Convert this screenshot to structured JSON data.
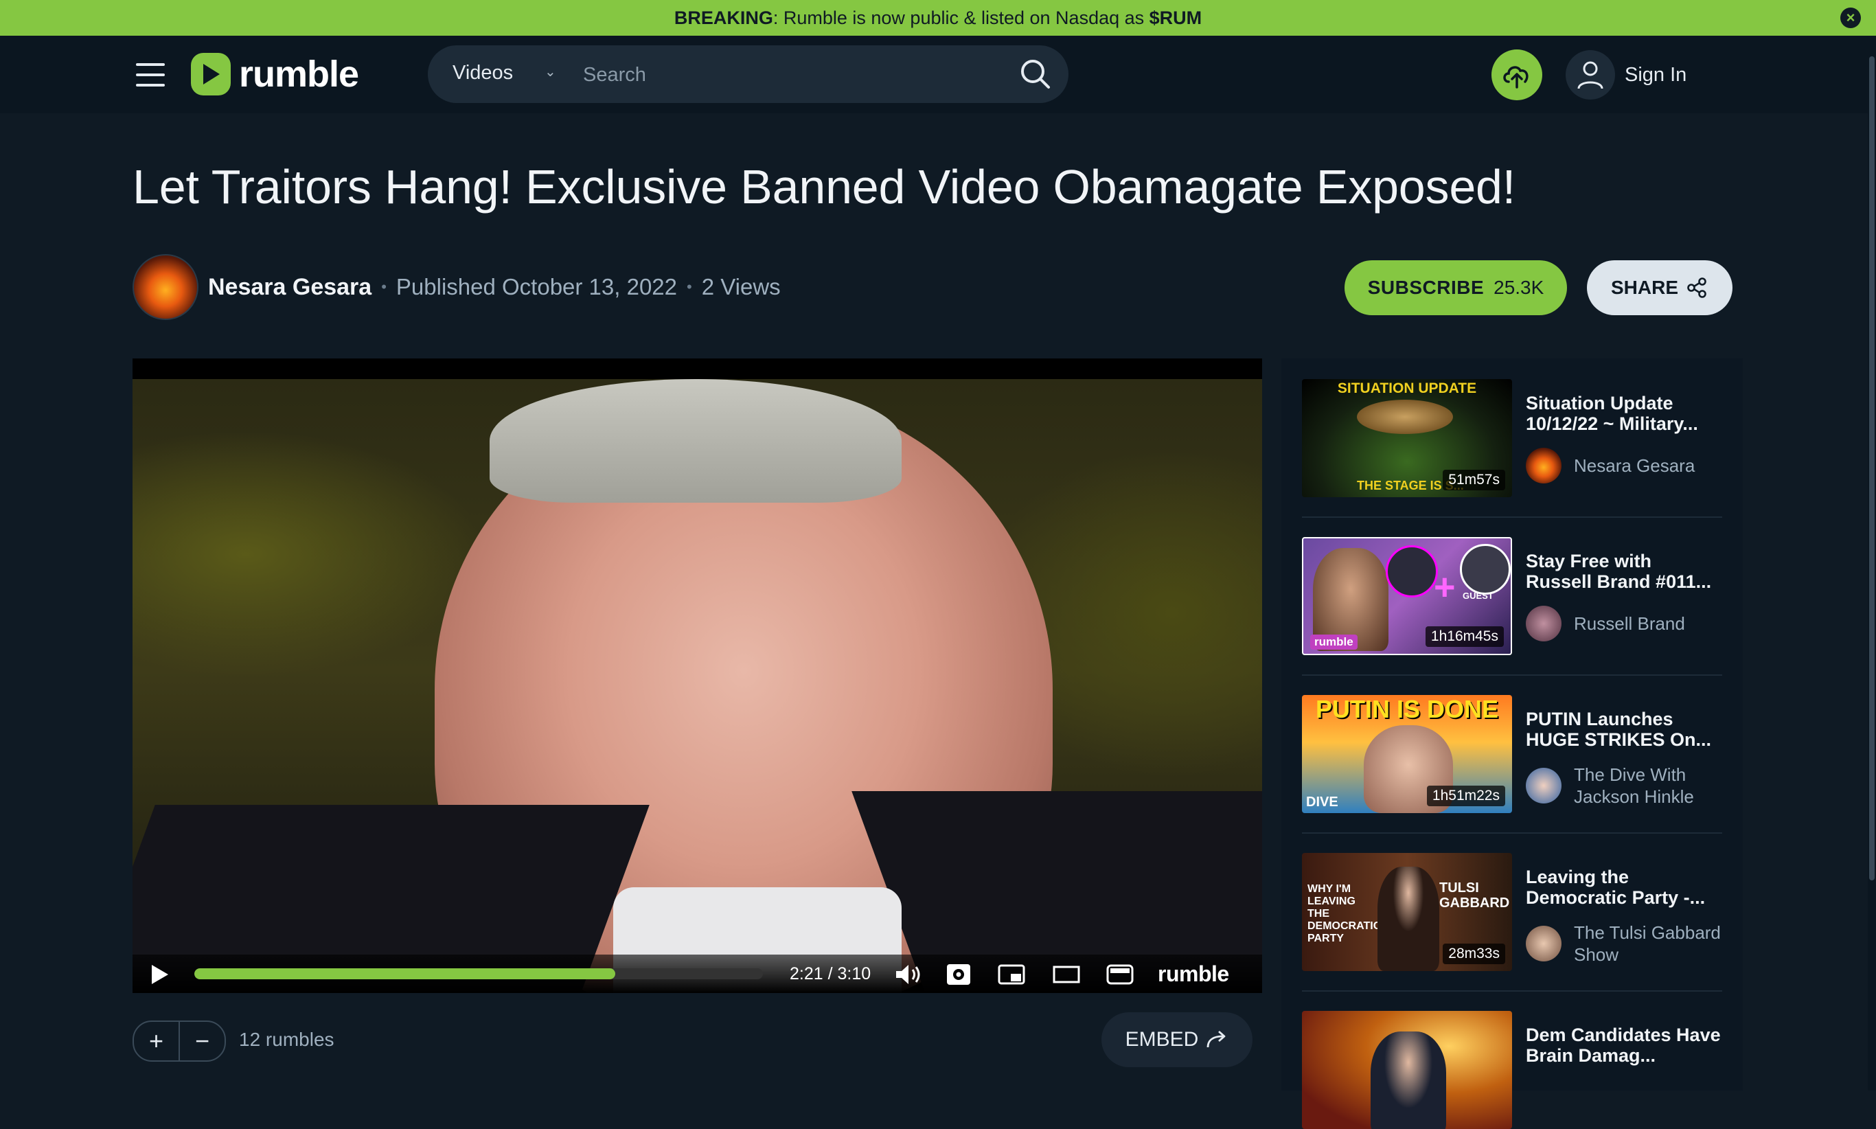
{
  "banner": {
    "label": "BREAKING",
    "message": ": Rumble is now public & listed on Nasdaq as ",
    "ticker": "$RUM",
    "close": "×"
  },
  "header": {
    "logo_text": "rumble",
    "search_category": "Videos",
    "search_placeholder": "Search",
    "sign_in": "Sign In"
  },
  "video": {
    "title": "Let Traitors Hang! Exclusive Banned Video Obamagate Exposed!",
    "channel": "Nesara Gesara",
    "published": "Published October 13, 2022",
    "views": "2 Views",
    "subscribe_label": "SUBSCRIBE",
    "subscribers": "25.3K",
    "share_label": "SHARE",
    "time": "2:21 / 3:10",
    "progress": 0.74,
    "player_brand": "rumble",
    "rumbles": "12 rumbles",
    "embed_label": "EMBED"
  },
  "related": [
    {
      "title": "Situation Update 10/12/22 ~ Military...",
      "channel": "Nesara Gesara",
      "duration": "51m57s",
      "thumb_text": "SITUATION UPDATE",
      "thumb_text2": "THE STAGE IS S..."
    },
    {
      "title": "Stay Free with Russell Brand #011...",
      "channel": "Russell Brand",
      "duration": "1h16m45s",
      "thumb_text": "GUEST",
      "thumb_text2": "rumble"
    },
    {
      "title": "PUTIN Launches HUGE STRIKES On...",
      "channel": "The Dive With Jackson Hinkle",
      "duration": "1h51m22s",
      "thumb_text": "PUTIN IS DONE",
      "thumb_text2": "DIVE"
    },
    {
      "title": "Leaving the Democratic Party -...",
      "channel": "The Tulsi Gabbard Show",
      "duration": "28m33s",
      "thumb_text": "WHY I'M LEAVING THE DEMOCRATIC PARTY",
      "thumb_text2": "TULSI GABBARD"
    },
    {
      "title": "Dem Candidates Have Brain Damag...",
      "channel": "",
      "duration": "",
      "thumb_text": "",
      "thumb_text2": ""
    }
  ],
  "colors": {
    "accent": "#85c742",
    "background": "#0f1a24"
  }
}
